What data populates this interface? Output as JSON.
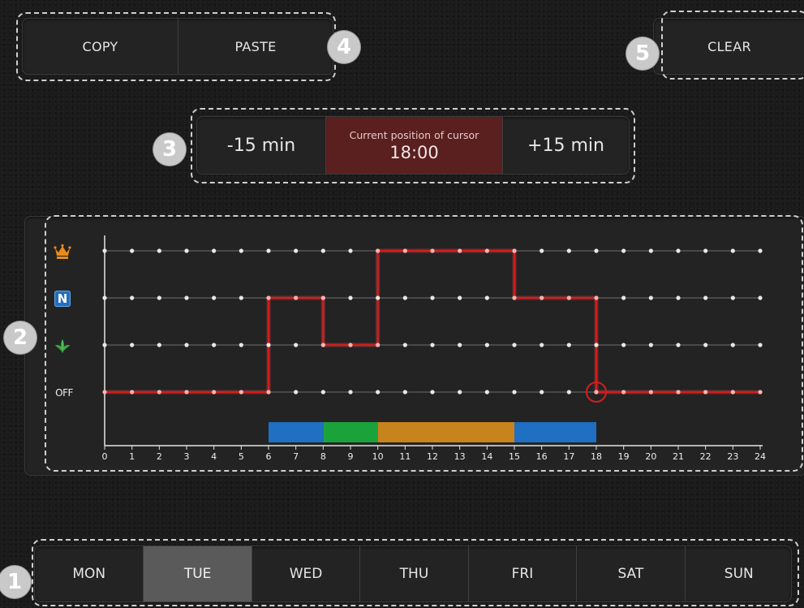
{
  "clipboard": {
    "copy_label": "COPY",
    "paste_label": "PASTE",
    "badge": "4"
  },
  "clear": {
    "label": "CLEAR",
    "badge": "5"
  },
  "cursor": {
    "minus_label": "-15 min",
    "caption": "Current position of cursor",
    "time": "18:00",
    "plus_label": "+15 min",
    "badge": "3"
  },
  "schedule": {
    "badge": "2",
    "modes": [
      {
        "name": "comfort",
        "icon": "crown-icon",
        "label": ""
      },
      {
        "name": "night",
        "icon": "night-n-icon",
        "label": "N"
      },
      {
        "name": "eco",
        "icon": "leaf-icon",
        "label": ""
      },
      {
        "name": "off",
        "icon": "",
        "label": "OFF"
      }
    ],
    "x_ticks": [
      "0",
      "1",
      "2",
      "3",
      "4",
      "5",
      "6",
      "7",
      "8",
      "9",
      "10",
      "11",
      "12",
      "13",
      "14",
      "15",
      "16",
      "17",
      "18",
      "19",
      "20",
      "21",
      "22",
      "23",
      "24"
    ],
    "cursor_hour": 18,
    "colors": {
      "line": "#d21f1f",
      "comfort": "#c7841c",
      "night": "#1f6fc2",
      "eco": "#1aa33a",
      "grid_dot": "#e8e8e8"
    },
    "chart_data": {
      "type": "line",
      "x": [
        0,
        6,
        6,
        8,
        8,
        10,
        10,
        15,
        15,
        18,
        18,
        24
      ],
      "y_levels": [
        "OFF",
        "eco",
        "N",
        "comfort"
      ],
      "segments": [
        {
          "from": 0,
          "to": 6,
          "level": "OFF"
        },
        {
          "from": 6,
          "to": 8,
          "level": "N"
        },
        {
          "from": 8,
          "to": 10,
          "level": "eco"
        },
        {
          "from": 10,
          "to": 15,
          "level": "comfort"
        },
        {
          "from": 15,
          "to": 18,
          "level": "N"
        },
        {
          "from": 18,
          "to": 24,
          "level": "OFF"
        }
      ],
      "xlim": [
        0,
        24
      ]
    }
  },
  "days": {
    "badge": "1",
    "selected": "TUE",
    "items": [
      "MON",
      "TUE",
      "WED",
      "THU",
      "FRI",
      "SAT",
      "SUN"
    ]
  }
}
